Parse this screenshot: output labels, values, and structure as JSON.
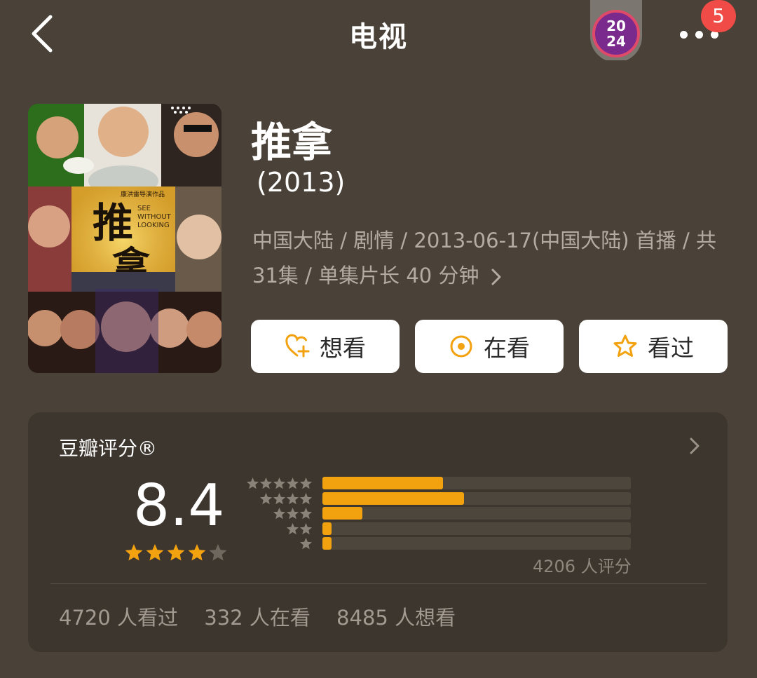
{
  "header": {
    "title": "电视",
    "year_badge_top": "20",
    "year_badge_bottom": "24",
    "notification_count": "5",
    "back_icon": "chevron-left-icon",
    "more_icon": "more-dots-icon"
  },
  "subject": {
    "title": "推拿",
    "year": "(2013)",
    "meta_line1": "中国大陆 / 剧情 / 2013-06-17(中国大陆) 首播 / 共",
    "meta_line2": "31集 / 单集片长 40 分钟",
    "poster_text": {
      "title": "推",
      "title2": "拿",
      "english": [
        "SEE",
        "WITHOUT",
        "LOOKING"
      ],
      "director": "康洪雷导演作品"
    }
  },
  "actions": [
    {
      "label": "想看",
      "icon": "heart-plus-icon"
    },
    {
      "label": "在看",
      "icon": "target-circle-icon"
    },
    {
      "label": "看过",
      "icon": "star-outline-icon"
    }
  ],
  "rating": {
    "card_title": "豆瓣评分®",
    "score": "8.4",
    "stars": 4,
    "distribution": [
      {
        "stars": 5,
        "fraction": 0.39
      },
      {
        "stars": 4,
        "fraction": 0.46
      },
      {
        "stars": 3,
        "fraction": 0.13
      },
      {
        "stars": 2,
        "fraction": 0.03
      },
      {
        "stars": 1,
        "fraction": 0.03
      }
    ],
    "rating_count": "4206 人评分",
    "stats": {
      "watched": "4720 人看过",
      "watching": "332 人在看",
      "want": "8485 人想看"
    }
  },
  "colors": {
    "background": "#4a4238",
    "card": "#3d362e",
    "accent": "#f2a20f",
    "badge_red": "#f04b46"
  }
}
